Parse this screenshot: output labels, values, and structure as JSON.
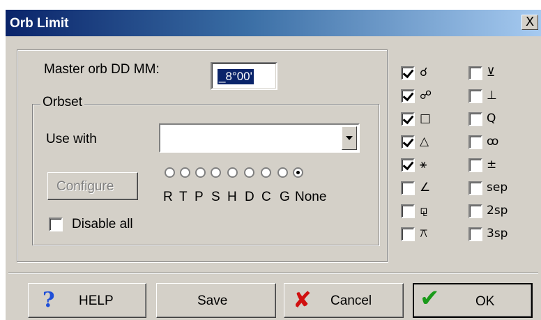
{
  "window": {
    "title": "Orb Limit",
    "close_label": "X"
  },
  "master_orb": {
    "label": "Master orb DD MM:",
    "value": "_8°00'"
  },
  "orbset": {
    "legend": "Orbset",
    "use_with_label": "Use with",
    "use_with_value": "",
    "configure_label": "Configure",
    "radio_options": [
      "R",
      "T",
      "P",
      "S",
      "H",
      "D",
      "C",
      "G",
      "None"
    ],
    "selected_radio": "None",
    "disable_all_label": "Disable all",
    "disable_all_checked": false
  },
  "aspects_left": [
    {
      "symbol": "☌",
      "checked": true
    },
    {
      "symbol": "☍",
      "checked": true
    },
    {
      "symbol": "□",
      "checked": true
    },
    {
      "symbol": "△",
      "checked": true
    },
    {
      "symbol": "⚹",
      "checked": true
    },
    {
      "symbol": "∠",
      "checked": false
    },
    {
      "symbol": "⚼",
      "checked": false
    },
    {
      "symbol": "⚻",
      "checked": false
    }
  ],
  "aspects_right": [
    {
      "symbol": "⊻",
      "checked": false
    },
    {
      "symbol": "⊥",
      "checked": false
    },
    {
      "symbol": "Q",
      "checked": false
    },
    {
      "symbol": "ꝏ",
      "checked": false
    },
    {
      "symbol": "±",
      "checked": false
    },
    {
      "symbol": "sep",
      "checked": false
    },
    {
      "symbol": "2sp",
      "checked": false
    },
    {
      "symbol": "3sp",
      "checked": false
    }
  ],
  "buttons": {
    "help": "HELP",
    "save": "Save",
    "cancel": "Cancel",
    "ok": "OK"
  },
  "colors": {
    "title_start": "#0a246a",
    "title_end": "#a6caf0",
    "face": "#d4d0c8",
    "help_icon": "#1f4fd8",
    "cancel_icon": "#d01010",
    "ok_icon": "#1a9a1a"
  }
}
